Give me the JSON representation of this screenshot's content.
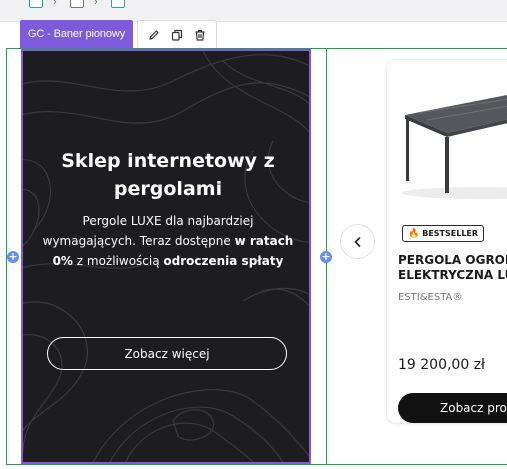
{
  "selection": {
    "label": "GC - Baner pionowy",
    "tools": [
      "edit-pencil-icon",
      "duplicate-icon",
      "delete-trash-icon"
    ]
  },
  "banner": {
    "title": "Sklep internetowy z pergolami",
    "desc_part1": "Pergole LUXE dla najbardziej wymagających. Teraz dostępne ",
    "desc_bold1": "w ratach 0%",
    "desc_part2": " z możliwością ",
    "desc_bold2": "odroczenia spłaty",
    "button_label": "Zobacz więcej"
  },
  "product": {
    "badge_label": "BESTSELLER",
    "name_line1": "PERGOLA OGRODOWA",
    "name_line2": "ELEKTRYCZNA LUXE",
    "brand": "ESTI&ESTA®",
    "price": "19 200,00 zł",
    "button_label": "Zobacz produkt"
  },
  "colors": {
    "selection_accent": "#7d5bdb",
    "container_outline": "#1fa14a",
    "banner_bg": "#1d1c1e",
    "handle": "#6a8cf0"
  }
}
